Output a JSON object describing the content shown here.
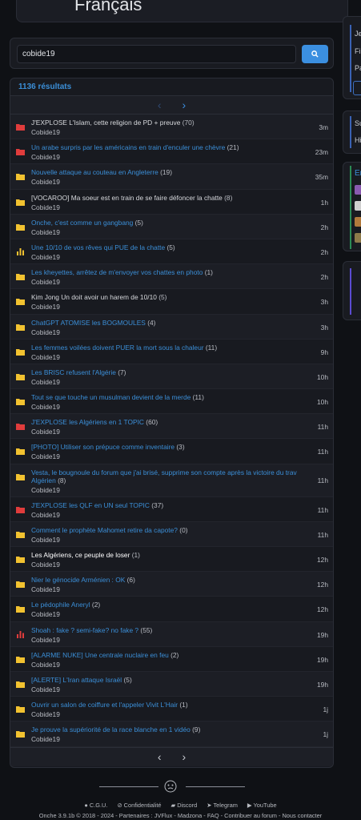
{
  "banner": {
    "text": "Français"
  },
  "sidebar": {
    "box1_lines": [
      "Je",
      "Fi",
      "Pa"
    ],
    "box2_lines": [
      "Su",
      "Hi"
    ],
    "box3_title": "Er"
  },
  "search": {
    "value": "cobide19"
  },
  "results": {
    "count_label": "1136 résultats",
    "topics": [
      {
        "title": "J'EXPLOSE L'Islam, cette religion de PD + preuve",
        "count": "(70)",
        "author": "Cobide19",
        "time": "3m",
        "icon": "folder-red",
        "link": false
      },
      {
        "title": "Un arabe surpris par les américains en train d'enculer une chèvre",
        "count": "(21)",
        "author": "Cobide19",
        "time": "23m",
        "icon": "folder-red",
        "link": true
      },
      {
        "title": "Nouvelle attaque au couteau en Angleterre",
        "count": "(19)",
        "author": "Cobide19",
        "time": "35m",
        "icon": "folder-yellow",
        "link": true
      },
      {
        "title": "[VOCAROO] Ma soeur est en train de se faire défoncer la chatte",
        "count": "(8)",
        "author": "Cobide19",
        "time": "1h",
        "icon": "folder-yellow",
        "link": false
      },
      {
        "title": "Onche, c'est comme un gangbang",
        "count": "(5)",
        "author": "Cobide19",
        "time": "2h",
        "icon": "folder-yellow",
        "link": true
      },
      {
        "title": "Une 10/10 de vos rêves qui PUE de la chatte",
        "count": "(5)",
        "author": "Cobide19",
        "time": "2h",
        "icon": "poll-yellow",
        "link": true
      },
      {
        "title": "Les kheyettes, arrêtez de m'envoyer vos chattes en photo",
        "count": "(1)",
        "author": "Cobide19",
        "time": "2h",
        "icon": "folder-yellow",
        "link": true
      },
      {
        "title": "Kim Jong Un doit avoir un harem de 10/10",
        "count": "(5)",
        "author": "Cobide19",
        "time": "3h",
        "icon": "folder-yellow",
        "link": false
      },
      {
        "title": "ChatGPT ATOMISE les BOGMOULES",
        "count": "(4)",
        "author": "Cobide19",
        "time": "3h",
        "icon": "folder-yellow",
        "link": true
      },
      {
        "title": "Les femmes voilées doivent PUER la mort sous la chaleur",
        "count": "(11)",
        "author": "Cobide19",
        "time": "9h",
        "icon": "folder-yellow",
        "link": true
      },
      {
        "title": "Les BRISC refusent l'Algérie",
        "count": "(7)",
        "author": "Cobide19",
        "time": "10h",
        "icon": "folder-yellow",
        "link": true
      },
      {
        "title": "Tout se que touche un musulman devient de la merde",
        "count": "(11)",
        "author": "Cobide19",
        "time": "10h",
        "icon": "folder-yellow",
        "link": true
      },
      {
        "title": "J'EXPLOSE les Algériens en 1 TOPIC",
        "count": "(60)",
        "author": "Cobide19",
        "time": "11h",
        "icon": "folder-red",
        "link": true
      },
      {
        "title": "[PHOTO] Utiliser son prépuce comme inventaire",
        "count": "(3)",
        "author": "Cobide19",
        "time": "11h",
        "icon": "folder-yellow",
        "link": true
      },
      {
        "title": "Vesta, le bougnoule du forum que j'ai brisé, supprime son compte après la victoire du trav Algérien",
        "count": "(8)",
        "author": "Cobide19",
        "time": "11h",
        "icon": "folder-yellow",
        "link": true,
        "tall": true
      },
      {
        "title": "J'EXPLOSE les QLF en UN seul TOPIC",
        "count": "(37)",
        "author": "Cobide19",
        "time": "11h",
        "icon": "folder-red",
        "link": true
      },
      {
        "title": "Comment le prophète Mahomet retire da capote?",
        "count": "(0)",
        "author": "Cobide19",
        "time": "11h",
        "icon": "folder-yellow",
        "link": true
      },
      {
        "title": "Les Algériens, ce peuple de loser",
        "count": "(1)",
        "author": "Cobide19",
        "time": "12h",
        "icon": "folder-yellow",
        "link": true,
        "white": true
      },
      {
        "title": "Nier le génocide Arménien : OK",
        "count": "(6)",
        "author": "Cobide19",
        "time": "12h",
        "icon": "folder-yellow",
        "link": true
      },
      {
        "title": "Le pédophile Aneryl",
        "count": "(2)",
        "author": "Cobide19",
        "time": "12h",
        "icon": "folder-yellow",
        "link": true
      },
      {
        "title": "Shoah : fake ? semi-fake? no fake ?",
        "count": "(55)",
        "author": "Cobide19",
        "time": "19h",
        "icon": "poll-red",
        "link": true
      },
      {
        "title": "[ALARME NUKE] Une centrale nuclaire en feu",
        "count": "(2)",
        "author": "Cobide19",
        "time": "19h",
        "icon": "folder-yellow",
        "link": true
      },
      {
        "title": "[ALERTE] L'Iran attaque Israël",
        "count": "(5)",
        "author": "Cobide19",
        "time": "19h",
        "icon": "folder-yellow",
        "link": true
      },
      {
        "title": "Ouvrir un salon de coiffure et l'appeler Vivit L'Hair",
        "count": "(1)",
        "author": "Cobide19",
        "time": "1j",
        "icon": "folder-yellow",
        "link": true
      },
      {
        "title": "Je prouve la supériorité de la race blanche en 1 vidéo",
        "count": "(9)",
        "author": "Cobide19",
        "time": "1j",
        "icon": "folder-yellow",
        "link": true
      }
    ]
  },
  "footer": {
    "links": [
      "C.G.U.",
      "Confidentialité",
      "Discord",
      "Telegram",
      "YouTube"
    ],
    "copyright": "Onche 3.9.1b © 2018 - 2024 - Partenaires : JVFlux - Madzona - FAQ - Contribuer au forum - Nous contacter"
  },
  "colors": {
    "accent": "#3b8fe0",
    "folder_yellow": "#f2c230",
    "folder_red": "#e03c3c"
  }
}
